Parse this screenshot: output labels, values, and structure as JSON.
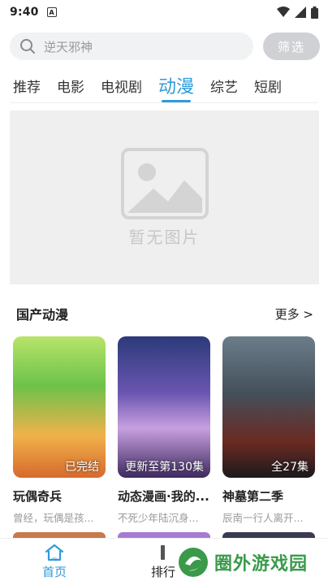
{
  "status_bar": {
    "time": "9:40",
    "notification_icon": "A"
  },
  "search": {
    "placeholder": "逆天邪神",
    "filter_label": "筛选"
  },
  "tabs": [
    {
      "label": "推荐",
      "active": false
    },
    {
      "label": "电影",
      "active": false
    },
    {
      "label": "电视剧",
      "active": false
    },
    {
      "label": "动漫",
      "active": true
    },
    {
      "label": "综艺",
      "active": false
    },
    {
      "label": "短剧",
      "active": false
    }
  ],
  "banner": {
    "placeholder_text": "暂无图片"
  },
  "section": {
    "title": "国产动漫",
    "more_label": "更多 >"
  },
  "cards": [
    {
      "title": "玩偶奇兵",
      "desc": "曾经，玩偶是孩...",
      "tag": "已完结"
    },
    {
      "title": "动态漫画·我的...",
      "desc": "不死少年陆沉身...",
      "tag": "更新至第130集"
    },
    {
      "title": "神墓第二季",
      "desc": "辰南一行人离开...",
      "tag": "全27集"
    }
  ],
  "bottom_nav": [
    {
      "label": "首页",
      "active": true
    },
    {
      "label": "排行",
      "active": false
    }
  ],
  "watermark": {
    "text": "圈外游戏园"
  },
  "colors": {
    "accent": "#2f9bd9",
    "filter_bg": "#cfd1d4",
    "watermark_green": "#3a9a4a"
  }
}
